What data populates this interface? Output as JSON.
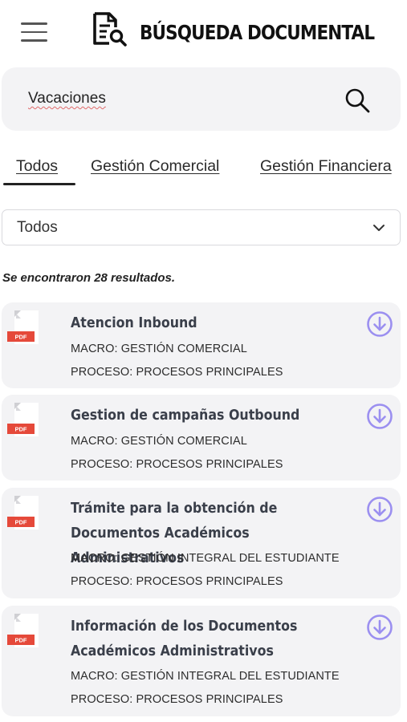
{
  "header": {
    "title": "BÚSQUEDA DOCUMENTAL",
    "menu_icon": "hamburger-menu-icon",
    "logo_icon": "document-search-icon"
  },
  "search": {
    "value": "Vacaciones",
    "icon": "search-icon"
  },
  "tabs": [
    {
      "label": "Todos",
      "active": true
    },
    {
      "label": "Gestión Comercial",
      "active": false
    },
    {
      "label": "Gestión Financiera",
      "active": false
    }
  ],
  "filter": {
    "selected": "Todos",
    "icon": "chevron-down-icon"
  },
  "results": {
    "count_text": "Se encontraron 28 resultados.",
    "items": [
      {
        "file_badge": "PDF",
        "title": "Atencion Inbound",
        "macro": "MACRO: GESTIÓN COMERCIAL",
        "proceso": "PROCESO: PROCESOS PRINCIPALES"
      },
      {
        "file_badge": "PDF",
        "title": "Gestion de campañas Outbound",
        "macro": "MACRO: GESTIÓN COMERCIAL",
        "proceso": "PROCESO: PROCESOS PRINCIPALES"
      },
      {
        "file_badge": "PDF",
        "title": "Trámite para la obtención de Documentos Académicos Administrativos",
        "macro": "MACRO: GESTIÓN INTEGRAL DEL ESTUDIANTE",
        "proceso": "PROCESO: PROCESOS PRINCIPALES"
      },
      {
        "file_badge": "PDF",
        "title": "Información de los Documentos Académicos Administrativos",
        "macro": "MACRO: GESTIÓN INTEGRAL DEL ESTUDIANTE",
        "proceso": "PROCESO: PROCESOS PRINCIPALES"
      }
    ]
  },
  "colors": {
    "accent": "#9b8ff0",
    "pdf_red": "#e5493a",
    "card_bg": "#f3f3f5"
  }
}
